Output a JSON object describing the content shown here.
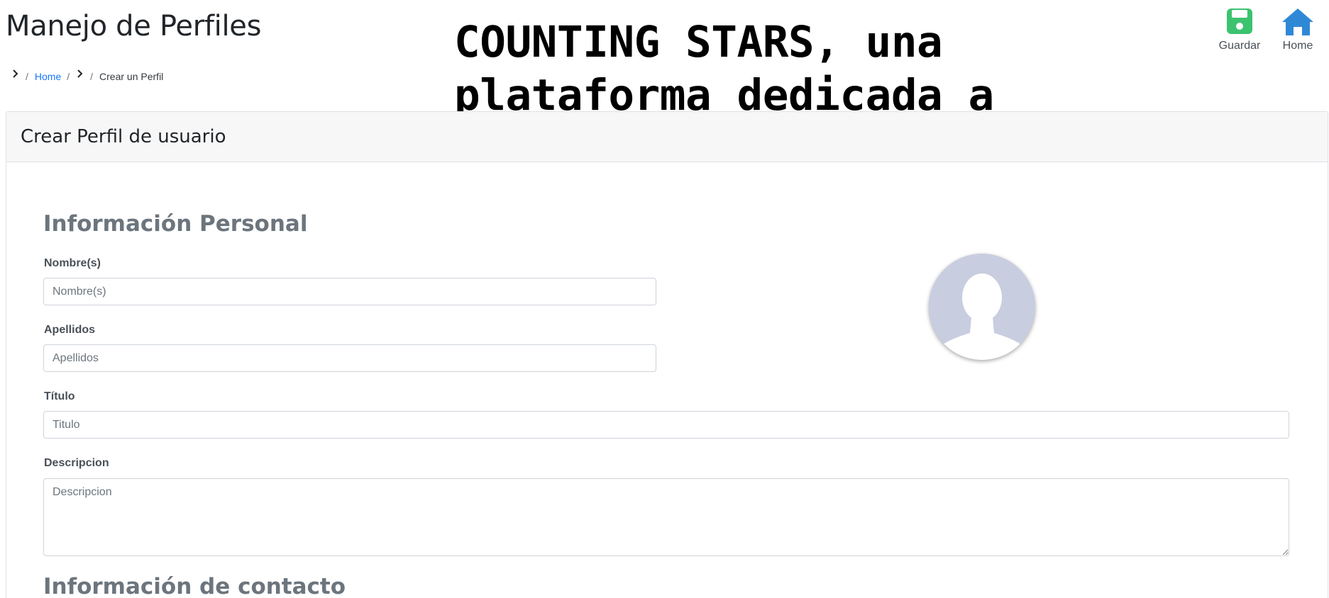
{
  "header": {
    "title": "Manejo de Perfiles"
  },
  "banner": {
    "text": "COUNTING STARS, una plataforma dedicada a facilitar la creación de curriculums"
  },
  "toolbar": {
    "save_label": "Guardar",
    "home_label": "Home",
    "save_color": "#3cc36f",
    "home_color": "#2f88d6"
  },
  "breadcrumb": {
    "home": "Home",
    "current": "Crear un Perfil"
  },
  "card": {
    "title": "Crear Perfil de usuario"
  },
  "personal": {
    "section_title": "Información Personal",
    "nombre_label": "Nombre(s)",
    "nombre_placeholder": "Nombre(s)",
    "apellidos_label": "Apellidos",
    "apellidos_placeholder": "Apellidos",
    "titulo_label": "Título",
    "titulo_placeholder": "Titulo",
    "descripcion_label": "Descripcion",
    "descripcion_placeholder": "Descripcion"
  },
  "contact": {
    "section_title": "Información de contacto"
  },
  "avatar": {
    "icon": "user-silhouette-icon",
    "background": "#c8cde0"
  }
}
